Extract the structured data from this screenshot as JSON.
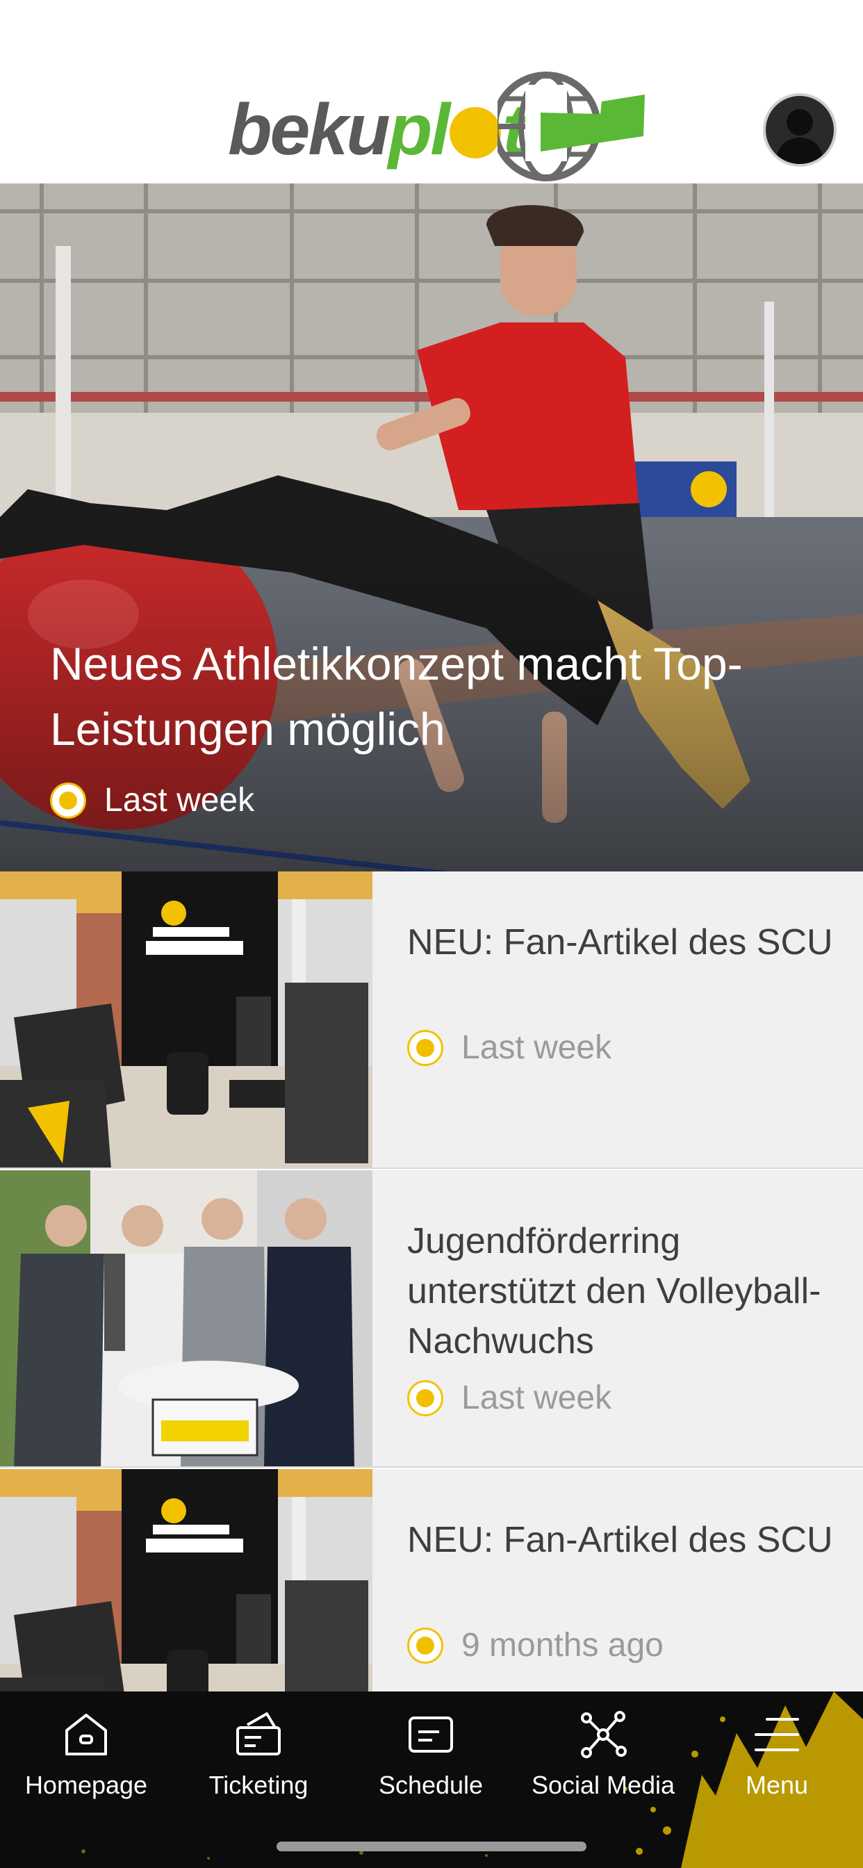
{
  "header": {
    "logo": {
      "text_dark": "beku",
      "text_green": "pl",
      "text_green2": "t",
      "alt": "bekuplast"
    },
    "avatar_icon": "user-avatar-icon"
  },
  "hero": {
    "title": "Neues Athletikkonzept macht Top-Leistungen möglich",
    "time": "Last week"
  },
  "news": [
    {
      "title": "NEU: Fan-Artikel des SCU",
      "time": "Last week"
    },
    {
      "title": "Jugendförderring unterstützt den Volleyball-Nachwuchs",
      "time": "Last week"
    },
    {
      "title": "NEU: Fan-Artikel des SCU",
      "time": "9 months ago"
    }
  ],
  "nav": [
    {
      "label": "Homepage",
      "icon": "home-icon"
    },
    {
      "label": "Ticketing",
      "icon": "ticket-icon"
    },
    {
      "label": "Schedule",
      "icon": "schedule-icon"
    },
    {
      "label": "Social Media",
      "icon": "network-icon"
    },
    {
      "label": "Menu",
      "icon": "menu-icon"
    }
  ],
  "colors": {
    "brand_yellow": "#f2c200",
    "brand_green": "#5bb836",
    "nav_bg": "#0c0c0c",
    "list_bg": "#f0f0f0"
  }
}
